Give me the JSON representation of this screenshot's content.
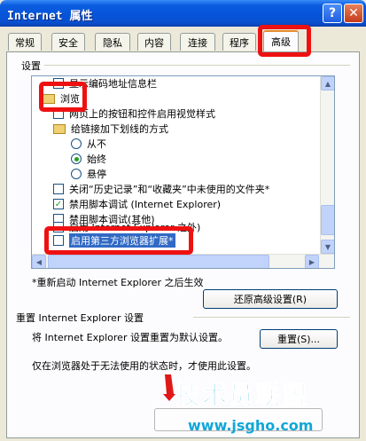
{
  "window": {
    "title": "Internet 属性"
  },
  "titlebar": {
    "help_glyph": "?",
    "close_glyph": "✕"
  },
  "tabs": [
    {
      "label": "常规"
    },
    {
      "label": "安全"
    },
    {
      "label": "隐私"
    },
    {
      "label": "内容"
    },
    {
      "label": "连接"
    },
    {
      "label": "程序"
    },
    {
      "label": "高级",
      "active": true
    }
  ],
  "settings": {
    "group_label": "设置",
    "items": [
      {
        "kind": "checkbox",
        "label": "显示编码地址信息栏",
        "checked": false
      },
      {
        "kind": "folder",
        "label": "浏览"
      },
      {
        "kind": "checkbox",
        "label": "网页上的按钮和控件启用视觉样式",
        "checked": false
      },
      {
        "kind": "folder",
        "label": "给链接加下划线的方式"
      },
      {
        "kind": "radio",
        "label": "从不",
        "checked": false
      },
      {
        "kind": "radio",
        "label": "始终",
        "checked": true
      },
      {
        "kind": "radio",
        "label": "悬停",
        "checked": false
      },
      {
        "kind": "checkbox",
        "label": "关闭“历史记录”和“收藏夹”中未使用的文件夹*",
        "checked": false
      },
      {
        "kind": "checkbox",
        "label": "禁用脚本调试 (Internet Explorer)",
        "checked": true
      },
      {
        "kind": "checkbox",
        "label": "禁用脚本调试(其他)",
        "checked": false
      },
      {
        "kind": "checkbox",
        "label": "启用 Internet Explorer 之外)",
        "checked": false
      },
      {
        "kind": "checkbox",
        "label": "启用第三方浏览器扩展*",
        "checked": false,
        "selected": true
      }
    ]
  },
  "restart_note": "*重新启动 Internet Explorer 之后生效",
  "restore_button": "还原高级设置(R)",
  "reset_section": {
    "title": "重置 Internet Explorer 设置",
    "description": "将 Internet Explorer 设置重置为默认设置。",
    "button": "重置(S)...",
    "warning": "仅在浏览器处于无法使用的状态时，才使用此设置。"
  },
  "watermark": {
    "text": "技术员联盟",
    "url": "www.jsgho.com"
  },
  "colors": {
    "titlebar": "#0654d8",
    "highlight": "#ee1111",
    "selection": "#316ac5",
    "checkmark": "#21a121"
  }
}
